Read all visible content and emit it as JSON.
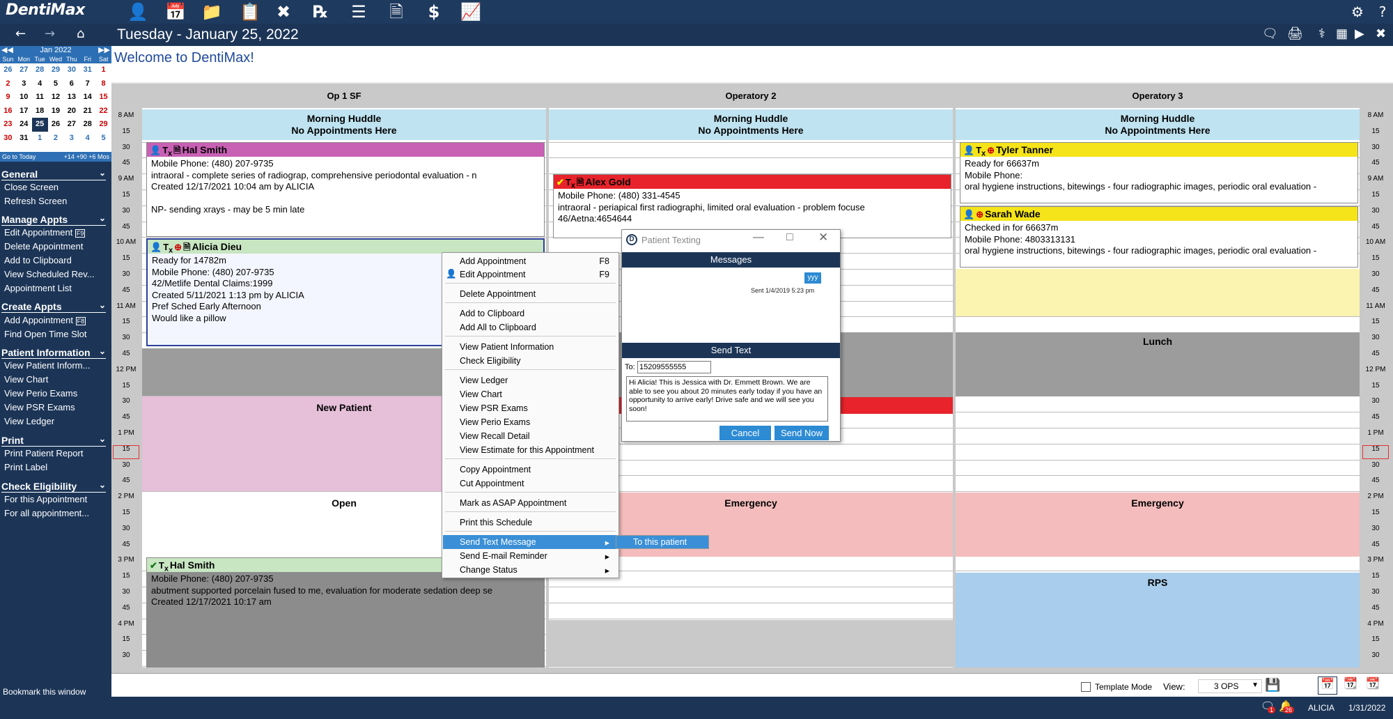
{
  "app": {
    "logo": "DentiMax",
    "date_title": "Tuesday - January 25, 2022",
    "welcome": "Welcome to DentiMax!"
  },
  "toolbar_icons": [
    "person-icon",
    "calendar-icon",
    "folder-icon",
    "clipboard-icon",
    "tools-icon",
    "rx-icon",
    "list-icon",
    "document-icon",
    "dollar-icon",
    "chart-icon"
  ],
  "calendar": {
    "month": "Jan 2022",
    "days": [
      "Sun",
      "Mon",
      "Tue",
      "Wed",
      "Thu",
      "Fri",
      "Sat"
    ],
    "footer": [
      "Go to Today",
      "+14",
      "+90",
      "+6 Mos"
    ]
  },
  "sidebar": {
    "general": "General",
    "close_screen": "Close Screen",
    "refresh_screen": "Refresh Screen",
    "manage": "Manage Appts",
    "edit_appt": "Edit Appointment",
    "f9": "F9",
    "delete_appt": "Delete Appointment",
    "add_clip": "Add to Clipboard",
    "view_sched": "View Scheduled Rev...",
    "appt_list": "Appointment List",
    "create": "Create Appts",
    "add_appt": "Add Appointment",
    "f8": "F8",
    "find_open": "Find Open Time Slot",
    "patient": "Patient Information",
    "view_patient": "View Patient Inform...",
    "view_chart": "View Chart",
    "view_perio": "View Perio Exams",
    "view_psr": "View PSR Exams",
    "view_ledger": "View Ledger",
    "print": "Print",
    "print_report": "Print Patient Report",
    "print_label": "Print Label",
    "check": "Check Eligibility",
    "for_this": "For this Appointment",
    "for_all": "For all appointment...",
    "bookmark": "Bookmark this window"
  },
  "ops": [
    "Op 1 SF",
    "Operatory 2",
    "Operatory 3"
  ],
  "huddle": {
    "title": "Morning Huddle",
    "sub": "No Appointments Here"
  },
  "blocks": {
    "new_patient": "New Patient",
    "open": "Open",
    "lunch": "Lunch",
    "emergency": "Emergency",
    "rps": "RPS"
  },
  "appts": {
    "hal1": {
      "name": "Hal Smith",
      "lines": [
        "Mobile Phone: (480) 207-9735",
        "intraoral - complete series of radiograp, comprehensive periodontal evaluation - n",
        "Created 12/17/2021 10:04 am by ALICIA",
        "",
        "NP- sending xrays - may be 5 min late"
      ]
    },
    "alicia": {
      "name": "Alicia Dieu",
      "lines": [
        "Ready for 14782m",
        "Mobile Phone: (480) 207-9735",
        "42/Metlife Dental Claims:1999",
        "Created 5/11/2021 1:13 pm by ALICIA",
        "Pref Sched Early Afternoon",
        "Would like a pillow"
      ]
    },
    "hal2": {
      "name": "Hal Smith",
      "lines": [
        "Mobile Phone: (480) 207-9735",
        "abutment supported porcelain fused to me, evaluation for moderate sedation deep se",
        "Created 12/17/2021 10:17 am"
      ]
    },
    "alex": {
      "name": "Alex Gold",
      "lines": [
        "Mobile Phone: (480) 331-4545",
        "intraoral - periapical first radiographi, limited oral evaluation - problem focuse",
        "46/Aetna:4654644"
      ]
    },
    "tyler": {
      "name": "Tyler Tanner",
      "lines": [
        "Ready for 66637m",
        "Mobile Phone:",
        "oral hygiene instructions, bitewings - four radiographic images, periodic oral evaluation -"
      ]
    },
    "sarah": {
      "name": "Sarah Wade",
      "lines": [
        "Checked in for 66637m",
        "Mobile Phone: 4803313131",
        "oral hygiene instructions, bitewings - four radiographic images, periodic oral evaluation -"
      ]
    }
  },
  "context_menu": {
    "add_appt": "Add Appointment",
    "add_key": "F8",
    "edit_appt": "Edit Appointment",
    "edit_key": "F9",
    "delete": "Delete Appointment",
    "add_clip": "Add to Clipboard",
    "add_all_clip": "Add All to Clipboard",
    "view_info": "View Patient Information",
    "check_elig": "Check Eligibility",
    "ledger": "View Ledger",
    "chart": "View Chart",
    "psr": "View PSR Exams",
    "perio": "View Perio Exams",
    "recall": "View Recall Detail",
    "estimate": "View Estimate for this Appointment",
    "copy": "Copy Appointment",
    "cut": "Cut Appointment",
    "asap": "Mark as ASAP Appointment",
    "print_sched": "Print this Schedule",
    "send_text": "Send Text Message",
    "send_email": "Send E-mail Reminder",
    "change_status": "Change Status",
    "submenu": "To this patient"
  },
  "dialog": {
    "title": "Patient Texting",
    "messages": "Messages",
    "bubble": "yyy",
    "sent": "Sent 1/4/2019 5:23 pm",
    "send_text": "Send Text",
    "to_label": "To:",
    "to_value": "15209555555",
    "message": "Hi Alicia! This is Jessica with Dr. Emmett Brown. We are able to see you about 20 minutes early today if you have an opportunity to arrive early! Drive safe and we will see you soon!",
    "cancel": "Cancel",
    "send_now": "Send Now"
  },
  "status": {
    "template_mode": "Template Mode",
    "view_label": "View:",
    "view_value": "3 OPS"
  },
  "bottom": {
    "badge1": "1",
    "badge2": "26",
    "user": "ALICIA",
    "date": "1/31/2022"
  },
  "colors": {
    "navy": "#1c3557",
    "accent": "#2d8bd4",
    "huddle": "#bfe3f0",
    "new_patient": "#e6bfd9",
    "emergency": "#f4bcbc",
    "rps": "#a9cdec",
    "lunch": "#9c9c9c"
  }
}
